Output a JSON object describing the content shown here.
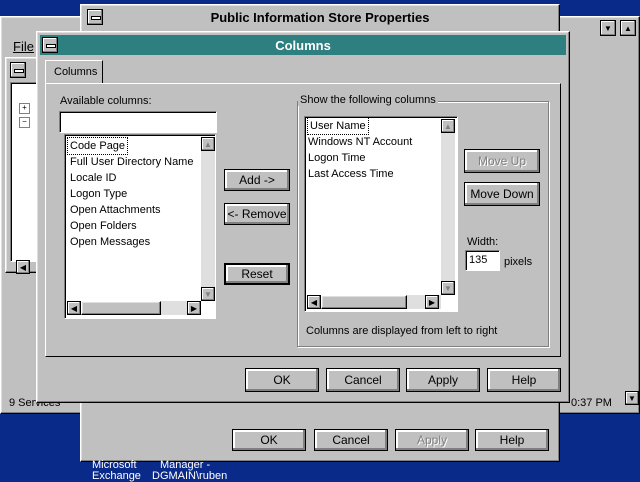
{
  "background_window": {
    "menu_file": "File",
    "status_services": "9 Services",
    "status_time": "0:37 PM",
    "bg_buttons": {
      "ok": "OK",
      "cancel": "Cancel",
      "apply": "Apply",
      "help": "Help"
    },
    "taskbar_text_1": "Microsoft",
    "taskbar_text_2": "Manager -",
    "taskbar_text_3": "Exchange",
    "taskbar_text_4": "DGMAIN\\ruben"
  },
  "properties_window": {
    "title": "Public Information Store Properties"
  },
  "columns_dialog": {
    "title": "Columns",
    "tab_label": "Columns",
    "available": {
      "label": "Available columns:",
      "filter_value": "",
      "items": [
        "Code Page",
        "Full User Directory Name",
        "Locale ID",
        "Logon Type",
        "Open Attachments",
        "Open Folders",
        "Open Messages"
      ]
    },
    "shown": {
      "group_label": "Show the following columns",
      "items": [
        "User Name",
        "Windows NT Account",
        "Logon Time",
        "Last Access Time"
      ],
      "note": "Columns are displayed from left to right"
    },
    "buttons": {
      "add": "Add ->",
      "remove": "<- Remove",
      "reset": "Reset",
      "move_up": "Move Up",
      "move_down": "Move Down",
      "ok": "OK",
      "cancel": "Cancel",
      "apply": "Apply",
      "help": "Help"
    },
    "width": {
      "label": "Width:",
      "value": "135",
      "unit": "pixels"
    }
  },
  "colors": {
    "desktop": "#0a2a8a",
    "dialog_title": "#2e7f7f",
    "face": "#c0c0c0"
  }
}
